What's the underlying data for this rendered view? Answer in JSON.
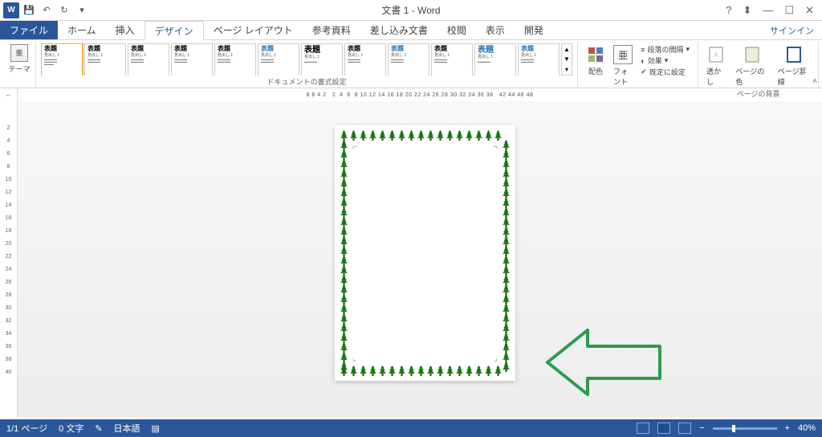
{
  "titlebar": {
    "doc_title": "文書 1 - Word",
    "signin": "サインイン"
  },
  "tabs": {
    "file": "ファイル",
    "items": [
      "ホーム",
      "挿入",
      "デザイン",
      "ページ レイアウト",
      "参考資料",
      "差し込み文書",
      "校閲",
      "表示",
      "開発"
    ],
    "active_index": 2
  },
  "ribbon": {
    "themes_label": "テーマ",
    "doc_format_label": "ドキュメントの書式設定",
    "page_bg_label": "ページの背景",
    "gallery_heading": "表題",
    "gallery_sub": "見出し 1",
    "colors": "配色",
    "fonts": "フォント",
    "para_spacing": "段落の間隔",
    "effects": "効果",
    "set_default": "既定に設定",
    "watermark": "透かし",
    "page_color": "ページの色",
    "page_border": "ページ罫線"
  },
  "ruler": {
    "h": "8 6 4 2   2  4  6  8 10 12 14 16 18 20 22 24 26 28 30 32 34 36 38   42 44 46 48",
    "v": [
      "2",
      "4",
      "6",
      "8",
      "10",
      "12",
      "14",
      "16",
      "18",
      "20",
      "22",
      "24",
      "26",
      "28",
      "30",
      "32",
      "34",
      "36",
      "38",
      "40"
    ]
  },
  "status": {
    "page": "1/1 ページ",
    "words": "0 文字",
    "lang": "日本語",
    "zoom": "40%"
  }
}
